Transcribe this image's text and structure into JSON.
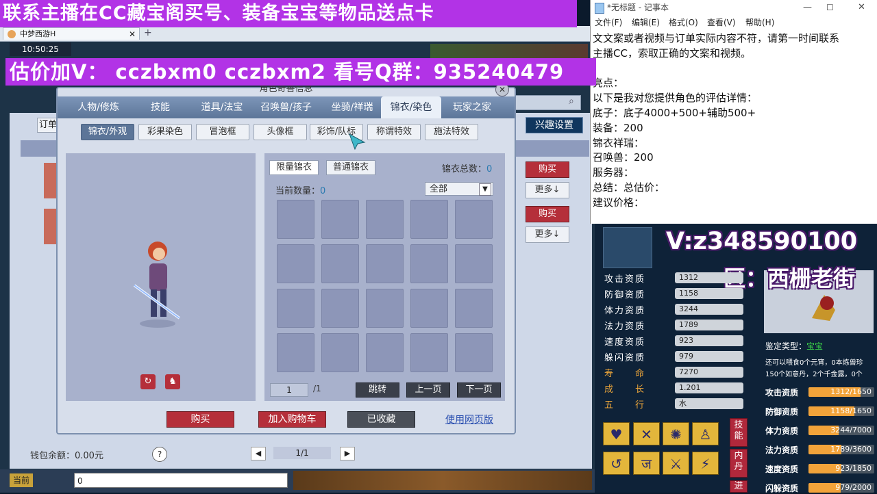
{
  "banners": {
    "top": "联系主播在CC藏宝阁买号、装备宝宝等物品送点卡",
    "price": "估价加V： cczbxm0  cczbxm2  看号Q群：935240479"
  },
  "game": {
    "tab_title": "中梦西游H",
    "clock": "10:50:25",
    "buy_label": "购买",
    "more_label": "更多↓",
    "fun_settings": "兴趣设置",
    "order_label": "订单",
    "wallet_label": "钱包余额：0.00元",
    "help_label": "?",
    "page_indicator": "1/1",
    "chat_channel": "当前",
    "chat_input": "0"
  },
  "dialog": {
    "title": "角色奇善信息",
    "tabs": [
      "人物/修炼",
      "技能",
      "道具/法宝",
      "召唤兽/孩子",
      "坐骑/祥瑞",
      "锦衣/染色",
      "玩家之家"
    ],
    "active_tab": 5,
    "subtabs": [
      "锦衣/外观",
      "彩果染色",
      "冒泡框",
      "头像框",
      "彩饰/队标",
      "称谓特效",
      "施法特效"
    ],
    "active_subtab": 0,
    "filter_tabs": [
      "限量锦衣",
      "普通锦衣"
    ],
    "total_label": "锦衣总数：",
    "total_value": "0",
    "count_label": "当前数量：",
    "count_value": "0",
    "filter_select": "全部",
    "page_input": "1",
    "page_total": "/1",
    "jump": "跳转",
    "prev": "上一页",
    "next": "下一页",
    "buy": "购买",
    "add_cart": "加入购物车",
    "collected": "已收藏",
    "web_link": "使用网页版"
  },
  "notepad": {
    "title": "*无标题 - 记事本",
    "menu": [
      "文件(F)",
      "编辑(E)",
      "格式(O)",
      "查看(V)",
      "帮助(H)"
    ],
    "lines": [
      "文文案或者视频与订单实际内容不符，请第一时间联系",
      "主播CC，索取正确的文案和视频。",
      "",
      "亮点：",
      "以下是我对您提供角色的评估详情：",
      "底子：底子4000+500+辅助500+",
      "装备：200",
      "锦衣祥瑞：",
      "召唤兽：200",
      "服务器：",
      "总结：总估价：",
      "建议价格："
    ]
  },
  "overlay": {
    "wechat": "V:z348590100",
    "region": "区：西栅老街"
  },
  "pet": {
    "stats": [
      {
        "label": "攻击资质",
        "value": "1312"
      },
      {
        "label": "防御资质",
        "value": "1158"
      },
      {
        "label": "体力资质",
        "value": "3244"
      },
      {
        "label": "法力资质",
        "value": "1789"
      },
      {
        "label": "速度资质",
        "value": "923"
      },
      {
        "label": "躲闪资质",
        "value": "979"
      },
      {
        "label": "寿　　命",
        "value": "7270"
      },
      {
        "label": "成　　长",
        "value": "1.201"
      },
      {
        "label": "五　　行",
        "value": "水"
      }
    ],
    "identify_label": "鉴定类型：",
    "identify_value": "宝宝",
    "note1": "还可以喂食0个元宵，0本炼兽珍",
    "note2": "150个如意丹，2个千金露，0个",
    "bars": [
      {
        "label": "攻击资质",
        "text": "1312/1650",
        "pct": 0.795
      },
      {
        "label": "防御资质",
        "text": "1158/1650",
        "pct": 0.702
      },
      {
        "label": "体力资质",
        "text": "3244/7000",
        "pct": 0.463
      },
      {
        "label": "法力资质",
        "text": "1789/3600",
        "pct": 0.497
      },
      {
        "label": "速度资质",
        "text": "923/1850",
        "pct": 0.499
      },
      {
        "label": "闪躲资质",
        "text": "979/2000",
        "pct": 0.49
      }
    ],
    "side_tabs": [
      "技能",
      "内丹",
      "进"
    ]
  },
  "colors": {
    "banner": "#b233e6",
    "buy_red": "#b52f3a",
    "dialog_header": "#5d7699",
    "bar_fill": "#f2a33a"
  }
}
